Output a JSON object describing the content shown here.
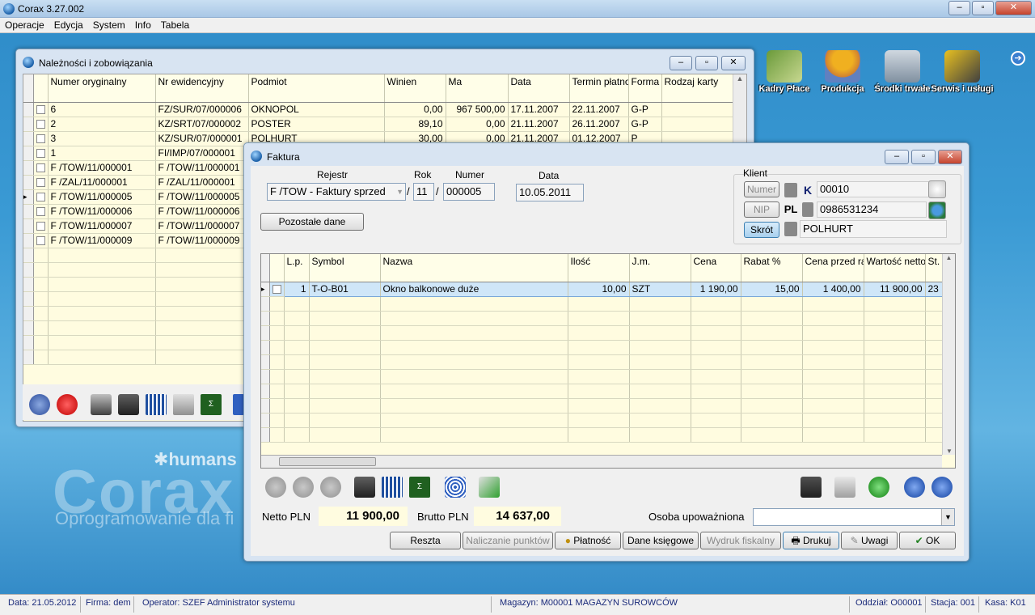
{
  "app": {
    "title": "Corax 3.27.002"
  },
  "menu": [
    "Operacje",
    "Edycja",
    "System",
    "Info",
    "Tabela"
  ],
  "desktop_icons": [
    {
      "label": "Kadry Płace",
      "icon": "money-icon"
    },
    {
      "label": "Produkcja",
      "icon": "worker-icon"
    },
    {
      "label": "Środki trwałe",
      "icon": "truck-icon"
    },
    {
      "label": "Serwis i usługi",
      "icon": "drill-icon"
    }
  ],
  "watermark": {
    "brand": "humans",
    "logo": "Corax",
    "tagline": "Oprogramowanie dla fi"
  },
  "nal": {
    "title": "Należności i zobowiązania",
    "columns": [
      "Numer oryginalny",
      "Nr ewidencyjny",
      "Podmiot",
      "Winien",
      "Ma",
      "Data",
      "Termin płatności",
      "Forma płatn.",
      "Rodzaj karty"
    ],
    "rows": [
      [
        "6",
        "FZ/SUR/07/000006",
        "OKNOPOL",
        "0,00",
        "967 500,00",
        "17.11.2007",
        "22.11.2007",
        "G-P",
        ""
      ],
      [
        "2",
        "KZ/SRT/07/000002",
        "POSTER",
        "89,10",
        "0,00",
        "21.11.2007",
        "26.11.2007",
        "G-P",
        ""
      ],
      [
        "3",
        "KZ/SUR/07/000001",
        "POLHURT",
        "30,00",
        "0,00",
        "21.11.2007",
        "01.12.2007",
        "P",
        ""
      ],
      [
        "1",
        "FI/IMP/07/000001",
        "",
        "",
        "",
        "",
        "",
        "",
        ""
      ],
      [
        "F /TOW/11/000001",
        "F /TOW/11/000001",
        "",
        "",
        "",
        "",
        "",
        "",
        ""
      ],
      [
        "F /ZAL/11/000001",
        "F /ZAL/11/000001",
        "",
        "",
        "",
        "",
        "",
        "",
        ""
      ],
      [
        "F /TOW/11/000005",
        "F /TOW/11/000005",
        "",
        "",
        "",
        "",
        "",
        "",
        ""
      ],
      [
        "F /TOW/11/000006",
        "F /TOW/11/000006",
        "",
        "",
        "",
        "",
        "",
        "",
        ""
      ],
      [
        "F /TOW/11/000007",
        "F /TOW/11/000007",
        "",
        "",
        "",
        "",
        "",
        "",
        ""
      ],
      [
        "F /TOW/11/000009",
        "F /TOW/11/000009",
        "",
        "",
        "",
        "",
        "",
        "",
        ""
      ]
    ]
  },
  "faktura": {
    "title": "Faktura",
    "rejestr_label": "Rejestr",
    "rok_label": "Rok",
    "numer_label": "Numer",
    "data_label": "Data",
    "rejestr": "F /TOW - Faktury sprzed",
    "rok": "11",
    "numer": "000005",
    "data": "10.05.2011",
    "slash": "/",
    "pozostale": "Pozostałe dane",
    "klient_label": "Klient",
    "btn_numer": "Numer",
    "btn_nip": "NIP",
    "btn_skrot": "Skrót",
    "k_prefix": "K",
    "kod": "00010",
    "pl_prefix": "PL",
    "nip": "0986531234",
    "skrot": "POLHURT",
    "columns": [
      "L.p.",
      "Symbol",
      "Nazwa",
      "Ilość",
      "J.m.",
      "Cena",
      "Rabat %",
      "Cena przed rabatem",
      "Wartość netto",
      "St. VAT"
    ],
    "items": [
      [
        "1",
        "T-O-B01",
        "Okno balkonowe duże",
        "10,00",
        "SZT",
        "1 190,00",
        "15,00",
        "1 400,00",
        "11 900,00",
        "23"
      ]
    ],
    "netto_label": "Netto PLN",
    "netto": "11 900,00",
    "brutto_label": "Brutto PLN",
    "brutto": "14 637,00",
    "osoba_label": "Osoba upoważniona",
    "osoba": "",
    "buttons": {
      "reszta": "Reszta",
      "naliczanie": "Naliczanie punktów",
      "platnosc": "Płatność",
      "dane": "Dane księgowe",
      "wydruk": "Wydruk fiskalny",
      "drukuj": "Drukuj",
      "uwagi": "Uwagi",
      "ok": "OK"
    }
  },
  "status": {
    "data": "Data: 21.05.2012",
    "firma": "Firma: dem",
    "operator": "Operator: SZEF Administrator systemu",
    "magazyn": "Magazyn: M00001 MAGAZYN SUROWCÓW",
    "oddzial": "Oddział: O00001",
    "stacja": "Stacja: 001",
    "kasa": "Kasa: K01"
  }
}
